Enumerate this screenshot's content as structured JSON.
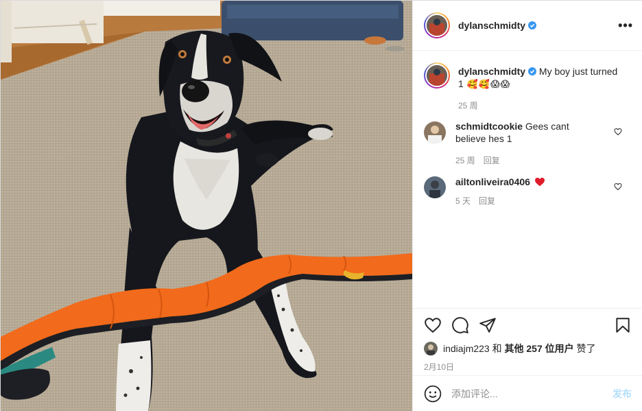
{
  "post": {
    "photo_alt": "dog",
    "author": "dylanschmidty",
    "verified": true
  },
  "caption": {
    "username": "dylanschmidty",
    "text": "My boy just turned 1",
    "emojis": [
      "🥰",
      "🥰",
      "😱",
      "😱"
    ],
    "time": "25 周"
  },
  "comments": [
    {
      "username": "schmidtcookie",
      "text": "Gees cant believe hes 1",
      "time": "25 周",
      "reply_label": "回复",
      "avatar_color": "#8a7560"
    },
    {
      "username": "ailtonliveira0406",
      "text": "",
      "time": "5 天",
      "reply_label": "回复",
      "avatar_color": "#5a6a7a"
    }
  ],
  "likes": {
    "first_user": "indiajm223",
    "joiner": " 和 ",
    "others": "其他 257 位用户",
    "suffix": " 赞了"
  },
  "date": "2月10日",
  "comment_box": {
    "placeholder": "添加评论...",
    "post_label": "发布"
  },
  "colors": {
    "verified": "#3897f0",
    "like_heart": "#ed4956",
    "post_button_disabled": "#b2dffc",
    "meta_gray": "#8e8e8e",
    "toy_orange": "#f26a1b"
  }
}
